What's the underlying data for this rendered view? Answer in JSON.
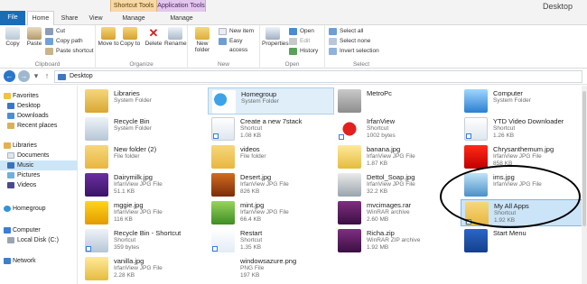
{
  "window": {
    "title": "Desktop"
  },
  "context_groups": {
    "shortcut_tools": "Shortcut Tools",
    "application_tools": "Application Tools"
  },
  "tabs": {
    "file": "File",
    "home": "Home",
    "share": "Share",
    "view": "View",
    "manage1": "Manage",
    "manage2": "Manage"
  },
  "ribbon": {
    "clipboard": {
      "copy": "Copy",
      "paste": "Paste",
      "cut": "Cut",
      "copy_path": "Copy path",
      "paste_shortcut": "Paste shortcut",
      "label": "Clipboard"
    },
    "organize": {
      "move_to": "Move to",
      "copy_to": "Copy to",
      "delete": "Delete",
      "rename": "Rename",
      "label": "Organize"
    },
    "new": {
      "new_folder": "New folder",
      "new_item": "New item",
      "easy_access": "Easy access",
      "label": "New"
    },
    "open": {
      "properties": "Properties",
      "open": "Open",
      "edit": "Edit",
      "history": "History",
      "label": "Open"
    },
    "select": {
      "select_all": "Select all",
      "select_none": "Select none",
      "invert_selection": "Invert selection",
      "label": "Select"
    }
  },
  "address": {
    "path": "Desktop"
  },
  "nav": {
    "favorites": "Favorites",
    "desktop": "Desktop",
    "downloads": "Downloads",
    "recent_places": "Recent places",
    "libraries": "Libraries",
    "documents": "Documents",
    "music": "Music",
    "pictures": "Pictures",
    "videos": "Videos",
    "homegroup": "Homegroup",
    "computer": "Computer",
    "local_disk": "Local Disk (C:)",
    "network": "Network"
  },
  "files": [
    {
      "name": "Libraries",
      "type": "System Folder",
      "size": ""
    },
    {
      "name": "Homegroup",
      "type": "System Folder",
      "size": ""
    },
    {
      "name": "MetroPc",
      "type": "",
      "size": ""
    },
    {
      "name": "Computer",
      "type": "System Folder",
      "size": ""
    },
    {
      "name": "Recycle Bin",
      "type": "System Folder",
      "size": ""
    },
    {
      "name": "Create a new 7stack",
      "type": "Shortcut",
      "size": "1.08 KB"
    },
    {
      "name": "IrfanView",
      "type": "Shortcut",
      "size": "1002 bytes"
    },
    {
      "name": "YTD Video Downloader",
      "type": "Shortcut",
      "size": "1.26 KB"
    },
    {
      "name": "New folder (2)",
      "type": "File folder",
      "size": ""
    },
    {
      "name": "videos",
      "type": "File folder",
      "size": ""
    },
    {
      "name": "banana.jpg",
      "type": "IrfanView JPG File",
      "size": "1.87 KB"
    },
    {
      "name": "Chrysanthemum.jpg",
      "type": "IrfanView JPG File",
      "size": "858 KB"
    },
    {
      "name": "Dairymilk.jpg",
      "type": "IrfanView JPG File",
      "size": "51.1 KB"
    },
    {
      "name": "Desert.jpg",
      "type": "IrfanView JPG File",
      "size": "826 KB"
    },
    {
      "name": "Dettol_Soap.jpg",
      "type": "IrfanView JPG File",
      "size": "32.2 KB"
    },
    {
      "name": "ims.jpg",
      "type": "IrfanView JPG File",
      "size": ""
    },
    {
      "name": "mggie.jpg",
      "type": "IrfanView JPG File",
      "size": "116 KB"
    },
    {
      "name": "mint.jpg",
      "type": "IrfanView JPG File",
      "size": "66.4 KB"
    },
    {
      "name": "mvcimages.rar",
      "type": "WinRAR archive",
      "size": "2.60 MB"
    },
    {
      "name": "My All Apps",
      "type": "Shortcut",
      "size": "1.92 KB"
    },
    {
      "name": "Recycle Bin - Shortcut",
      "type": "Shortcut",
      "size": "359 bytes"
    },
    {
      "name": "Restart",
      "type": "Shortcut",
      "size": "1.35 KB"
    },
    {
      "name": "Richa.zip",
      "type": "WinRAR ZIP archive",
      "size": "1.92 MB"
    },
    {
      "name": "Start Menu",
      "type": "",
      "size": ""
    },
    {
      "name": "vanilla.jpg",
      "type": "IrfanView JPG File",
      "size": "2.28 KB"
    },
    {
      "name": "windowsazure.png",
      "type": "PNG File",
      "size": "197 KB"
    }
  ]
}
